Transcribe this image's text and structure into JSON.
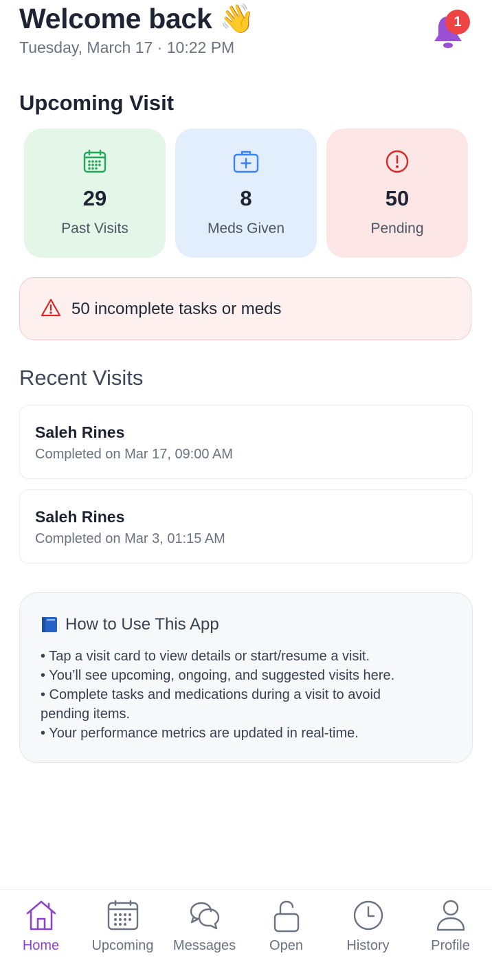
{
  "header": {
    "title": "Welcome back",
    "wave_emoji": "👋",
    "subtitle": "Tuesday, March 17 · 10:22 PM",
    "notification_count": "1",
    "bell_color": "#9b4fd4",
    "badge_color": "#ef4444"
  },
  "upcoming": {
    "title": "Upcoming Visit"
  },
  "stats": [
    {
      "value": "29",
      "label": "Past Visits",
      "icon": "calendar-icon",
      "bg": "#e3f6e8",
      "accent": "#22a75a"
    },
    {
      "value": "8",
      "label": "Meds Given",
      "icon": "medkit-icon",
      "bg": "#e3eefc",
      "accent": "#3b82f6"
    },
    {
      "value": "50",
      "label": "Pending",
      "icon": "alert-circle-icon",
      "bg": "#fde7e6",
      "accent": "#dc2626"
    }
  ],
  "alert": {
    "text": "50 incomplete tasks or meds",
    "icon": "warning-triangle-icon"
  },
  "recent": {
    "title": "Recent Visits",
    "visits": [
      {
        "name": "Saleh Rines",
        "status": "Completed on Mar 17, 09:00 AM"
      },
      {
        "name": "Saleh Rines",
        "status": "Completed on Mar 3, 01:15 AM"
      }
    ]
  },
  "help": {
    "icon": "book-icon",
    "title": "How to Use This App",
    "lines": [
      "• Tap a visit card to view details or start/resume a visit.",
      "• You’ll see upcoming, ongoing, and suggested visits here.",
      "• Complete tasks and medications during a visit to avoid",
      "pending items.",
      "• Your performance metrics are updated in real-time."
    ]
  },
  "nav": {
    "active_color": "#8e44c7",
    "items": [
      {
        "label": "Home",
        "icon": "home-icon",
        "active": true
      },
      {
        "label": "Upcoming",
        "icon": "calendar-icon",
        "active": false
      },
      {
        "label": "Messages",
        "icon": "chat-bubbles-icon",
        "active": false
      },
      {
        "label": "Open",
        "icon": "unlock-icon",
        "active": false
      },
      {
        "label": "History",
        "icon": "clock-icon",
        "active": false
      },
      {
        "label": "Profile",
        "icon": "person-icon",
        "active": false
      }
    ]
  }
}
